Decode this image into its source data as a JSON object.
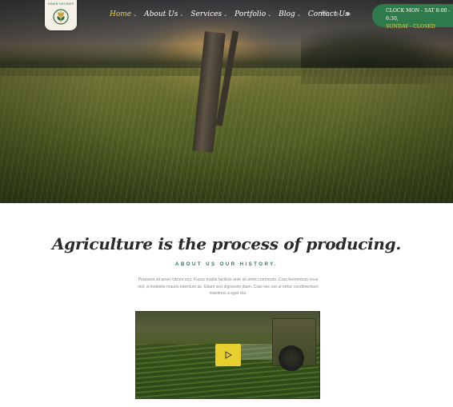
{
  "brand": {
    "logo_text": "GRAIN·GROWER"
  },
  "nav": {
    "items": [
      {
        "label": "Home",
        "active": true,
        "has_dropdown": true
      },
      {
        "label": "About Us",
        "active": false,
        "has_dropdown": true
      },
      {
        "label": "Services",
        "active": false,
        "has_dropdown": true
      },
      {
        "label": "Portfolio",
        "active": false,
        "has_dropdown": true
      },
      {
        "label": "Blog",
        "active": false,
        "has_dropdown": true
      },
      {
        "label": "Contact Us",
        "active": false,
        "has_dropdown": false
      }
    ],
    "chevron": "⌄"
  },
  "social": {
    "icons": [
      "behance-icon",
      "dribbble-icon",
      "instagram-icon"
    ],
    "glyphs": [
      "Bē",
      "◎",
      "◉"
    ]
  },
  "hours": {
    "line1": "CLOCK MON - SAT 8:00 - 6:30,",
    "line2": "SUNDAY - CLOSED"
  },
  "main": {
    "headline": "Agriculture is the process of producing.",
    "subheading": "ABOUT US OUR HISTORY.",
    "body": "Praesent sit amet rutrum orci. Fusce mattis facilisis ante sit amet commodo. Cras fermentum risus nisl, a molestie mauris interdum ac. Etiam sed dignissim diam. Cras nec est ut tortor condimentum maximus a eget dui."
  },
  "video": {
    "play_icon": "play-icon"
  },
  "colors": {
    "accent_green": "#2f7a4a",
    "accent_yellow": "#e6cf2e",
    "active_nav": "#e8d24a"
  }
}
